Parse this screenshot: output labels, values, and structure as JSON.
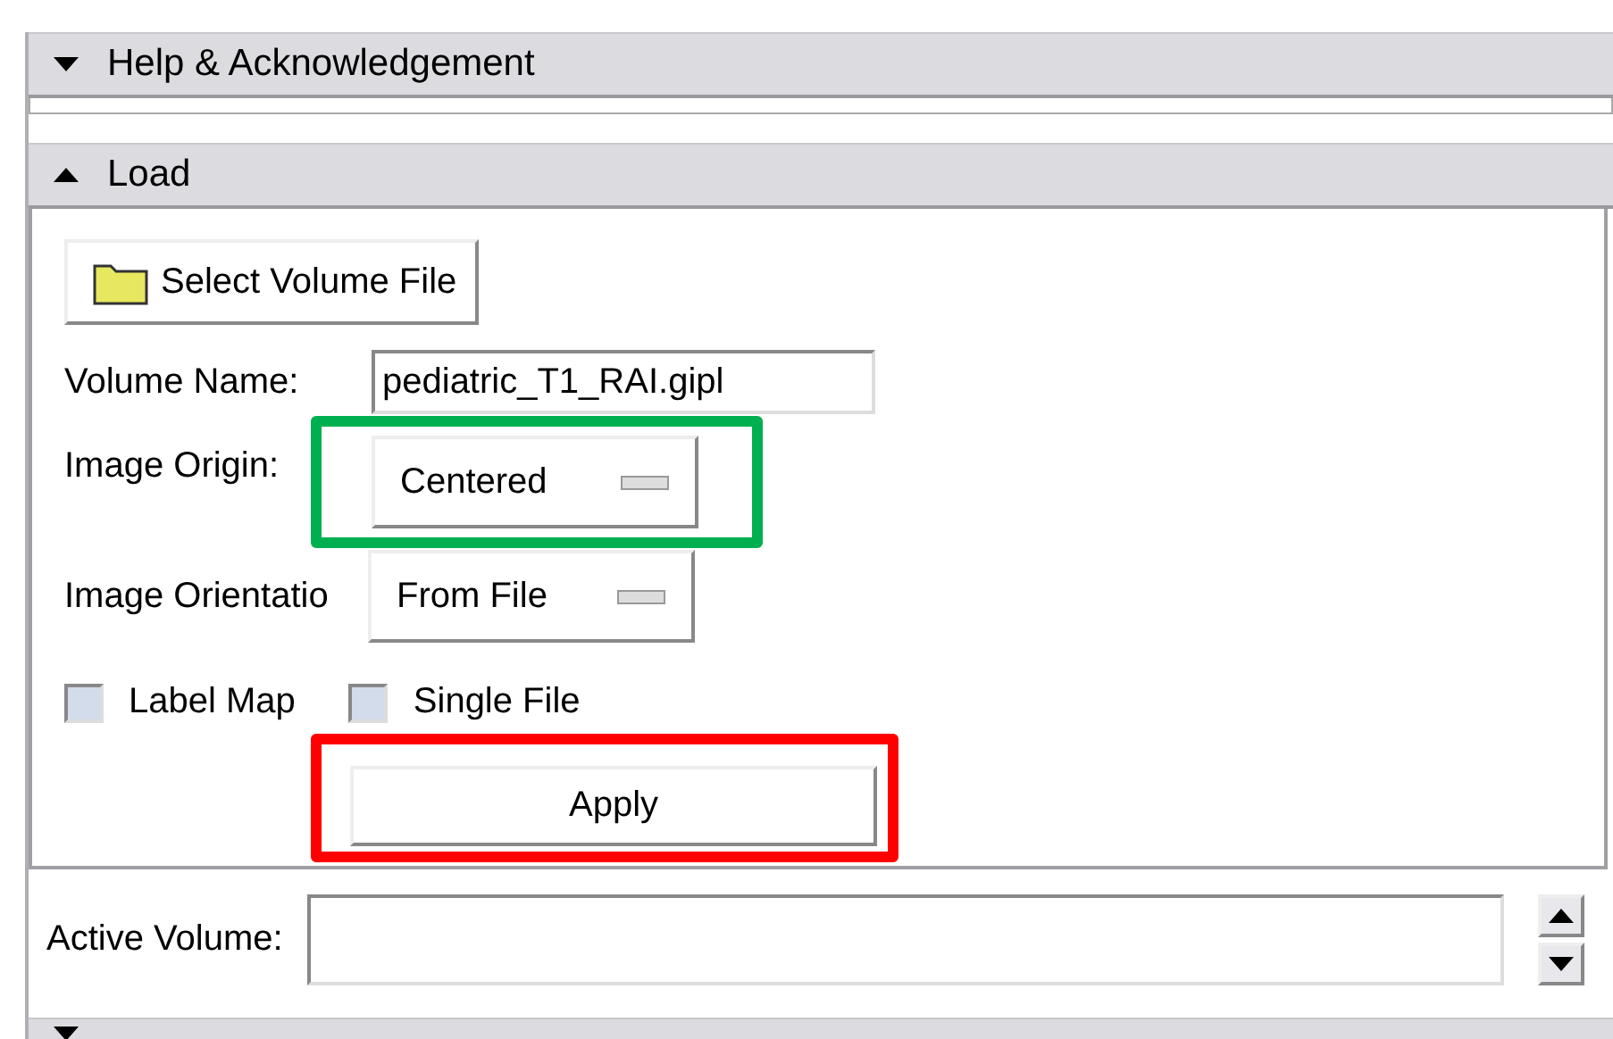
{
  "sections": [
    {
      "title": "Help & Acknowledgement",
      "expanded": false
    },
    {
      "title": "Load",
      "expanded": true
    }
  ],
  "load": {
    "select_button": "Select Volume File",
    "volume_name": {
      "label": "Volume Name:",
      "value": "pediatric_T1_RAI.gipl"
    },
    "menus": [
      {
        "label": "Image Origin:",
        "value": "Centered",
        "highlighted": true
      },
      {
        "label": "Image Orientatio",
        "value": "From File",
        "highlighted": false
      }
    ],
    "checkboxes": [
      {
        "label": "Label Map",
        "checked": false
      },
      {
        "label": "Single File",
        "checked": false
      }
    ],
    "apply": {
      "label": "Apply",
      "highlighted": true
    }
  },
  "active_volume": {
    "label": "Active Volume:"
  },
  "next_section": {
    "expanded": false
  }
}
